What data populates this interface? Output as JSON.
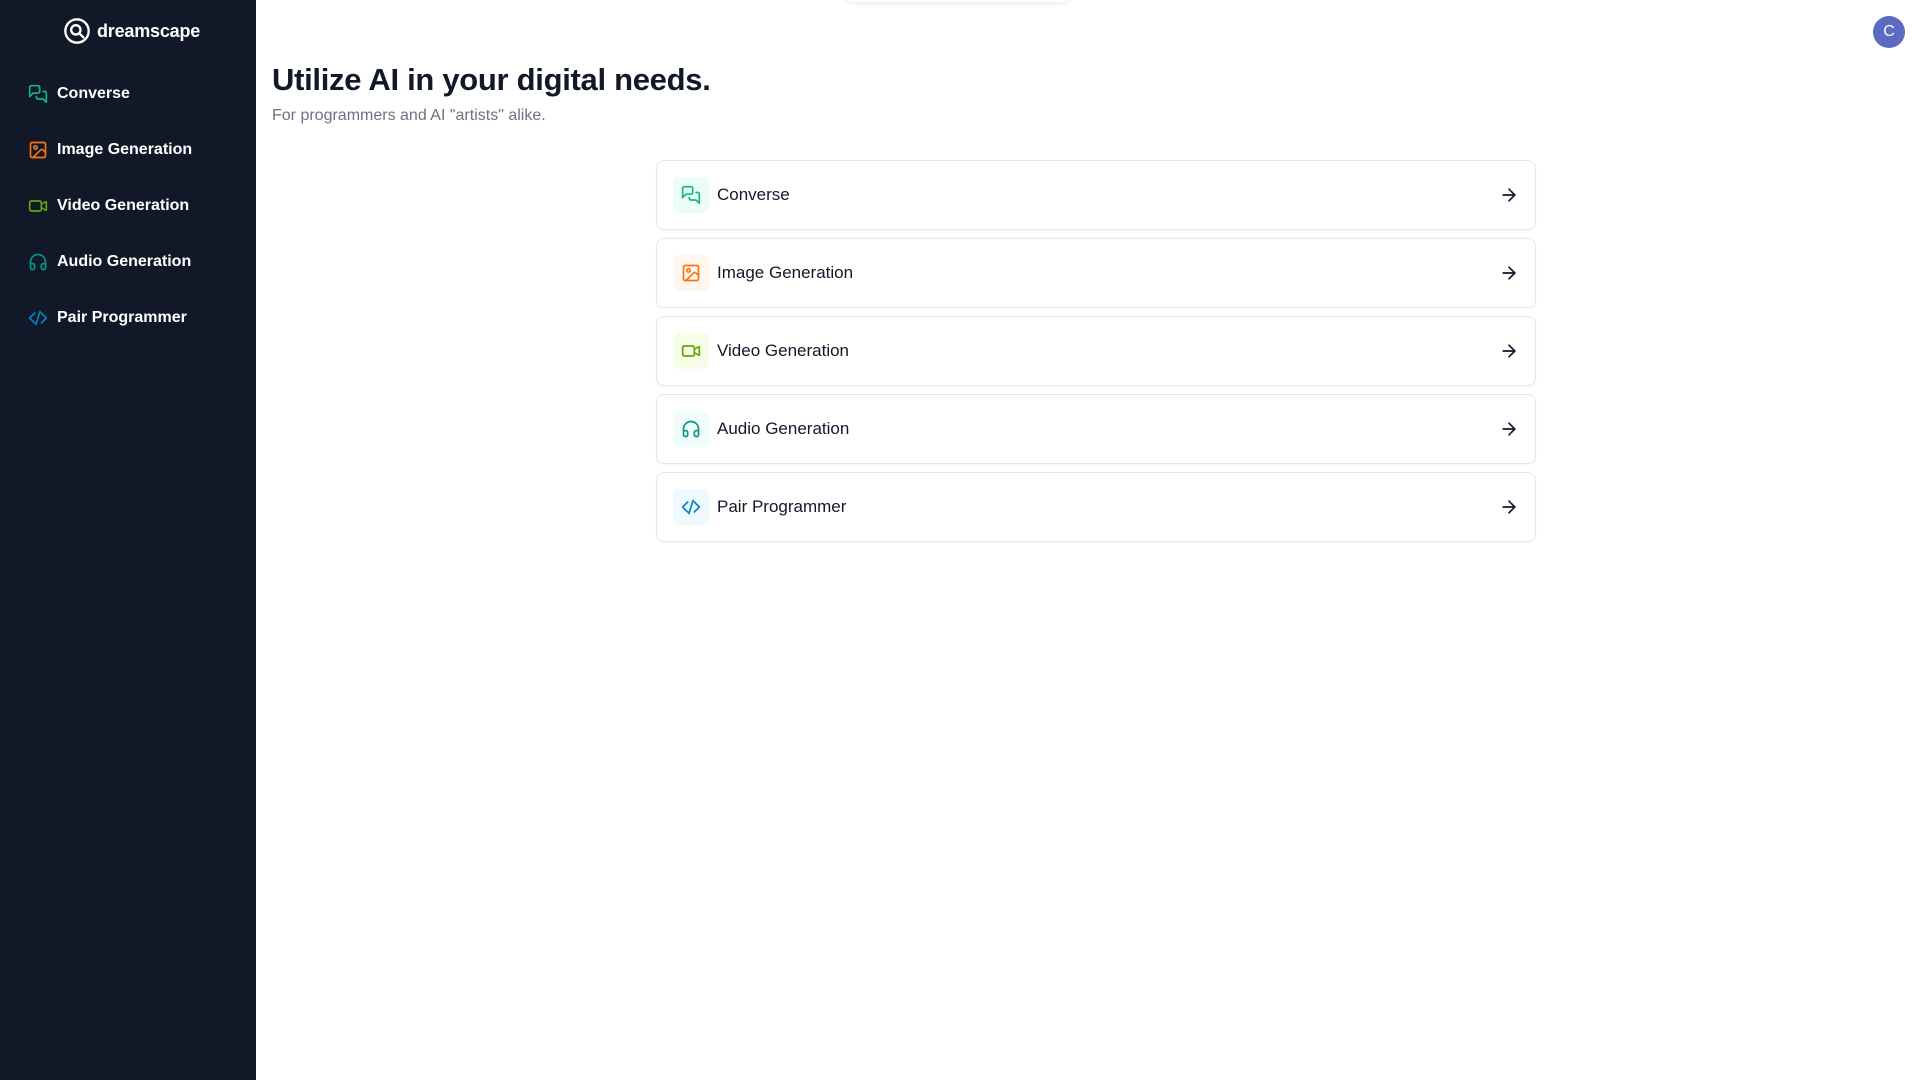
{
  "sidebar": {
    "logo": {
      "text": "dreamscape",
      "icon": "search-logo-icon"
    },
    "items": [
      {
        "label": "Converse",
        "icon": "messages-icon",
        "color": "#10b981"
      },
      {
        "label": "Image Generation",
        "icon": "image-icon",
        "color": "#f97316"
      },
      {
        "label": "Video Generation",
        "icon": "video-icon",
        "color": "#65a30d"
      },
      {
        "label": "Audio Generation",
        "icon": "headphones-icon",
        "color": "#0d9488"
      },
      {
        "label": "Pair Programmer",
        "icon": "code-icon",
        "color": "#0284c7"
      }
    ]
  },
  "header": {
    "avatar_initial": "C",
    "avatar_color": "#5c6bc0"
  },
  "main": {
    "title": "Utilize AI in your digital needs.",
    "subtitle": "For programmers and AI \"artists\" alike.",
    "cards": [
      {
        "label": "Converse",
        "icon": "messages-icon",
        "color": "#10b981",
        "bg": "#ecfdf5"
      },
      {
        "label": "Image Generation",
        "icon": "image-icon",
        "color": "#f97316",
        "bg": "#fff7ed"
      },
      {
        "label": "Video Generation",
        "icon": "video-icon",
        "color": "#65a30d",
        "bg": "#f7fee7"
      },
      {
        "label": "Audio Generation",
        "icon": "headphones-icon",
        "color": "#0d9488",
        "bg": "#f0fdfa"
      },
      {
        "label": "Pair Programmer",
        "icon": "code-icon",
        "color": "#0284c7",
        "bg": "#f0f9ff"
      }
    ],
    "arrow_icon": "arrow-right-icon"
  }
}
